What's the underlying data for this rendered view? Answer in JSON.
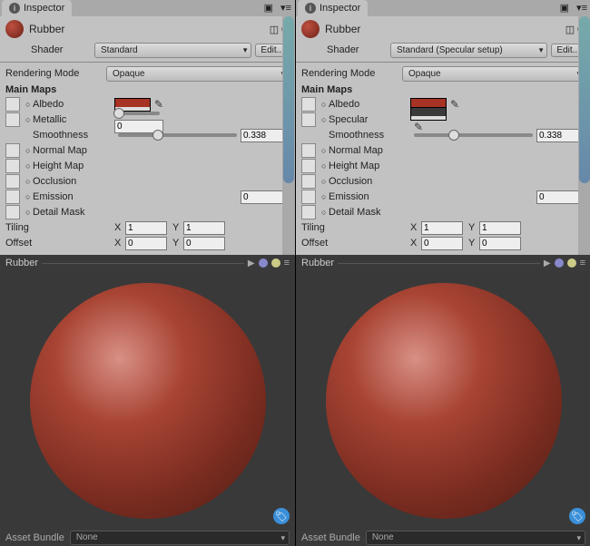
{
  "panels": [
    {
      "tab": "Inspector",
      "material": "Rubber",
      "shader_label": "Shader",
      "shader_value": "Standard",
      "edit_label": "Edit...",
      "rendering_mode_label": "Rendering Mode",
      "rendering_mode_value": "Opaque",
      "main_maps_label": "Main Maps",
      "albedo_label": "Albedo",
      "second_label": "Metallic",
      "second_is_color": false,
      "second_value": "0",
      "smoothness_label": "Smoothness",
      "smoothness_value": "0.338",
      "smoothness_pct": 33.8,
      "normal_label": "Normal Map",
      "height_label": "Height Map",
      "occlusion_label": "Occlusion",
      "emission_label": "Emission",
      "emission_value": "0",
      "detail_label": "Detail Mask",
      "tiling_label": "Tiling",
      "offset_label": "Offset",
      "tiling_x": "1",
      "tiling_y": "1",
      "offset_x": "0",
      "offset_y": "0",
      "preview_title": "Rubber",
      "asset_bundle_label": "Asset Bundle",
      "asset_bundle_value": "None"
    },
    {
      "tab": "Inspector",
      "material": "Rubber",
      "shader_label": "Shader",
      "shader_value": "Standard (Specular setup)",
      "edit_label": "Edit...",
      "rendering_mode_label": "Rendering Mode",
      "rendering_mode_value": "Opaque",
      "main_maps_label": "Main Maps",
      "albedo_label": "Albedo",
      "second_label": "Specular",
      "second_is_color": true,
      "second_value": "",
      "smoothness_label": "Smoothness",
      "smoothness_value": "0.338",
      "smoothness_pct": 33.8,
      "normal_label": "Normal Map",
      "height_label": "Height Map",
      "occlusion_label": "Occlusion",
      "emission_label": "Emission",
      "emission_value": "0",
      "detail_label": "Detail Mask",
      "tiling_label": "Tiling",
      "offset_label": "Offset",
      "tiling_x": "1",
      "tiling_y": "1",
      "offset_x": "0",
      "offset_y": "0",
      "preview_title": "Rubber",
      "asset_bundle_label": "Asset Bundle",
      "asset_bundle_value": "None"
    }
  ]
}
